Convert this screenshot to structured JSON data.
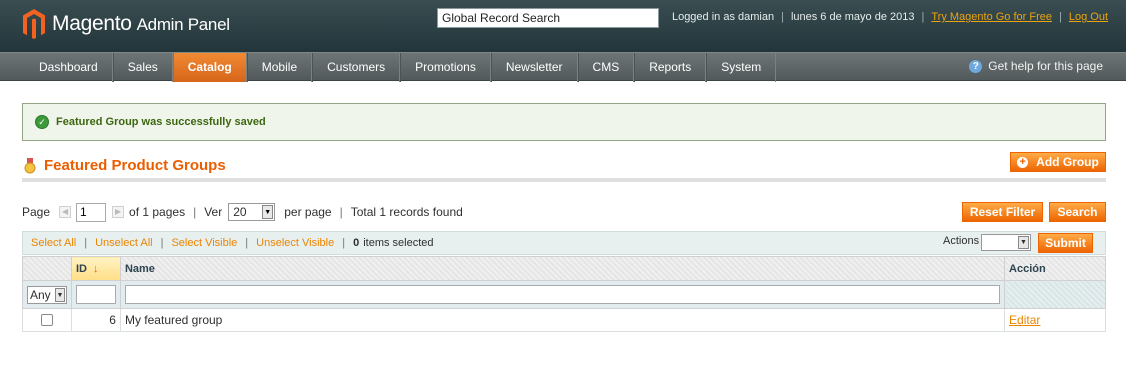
{
  "header": {
    "brand": "Magento",
    "brand_suffix": "Admin Panel",
    "search_value": "Global Record Search",
    "logged_in": "Logged in as damian",
    "date": "lunes 6 de mayo de 2013",
    "try_link": "Try Magento Go for Free",
    "logout": "Log Out"
  },
  "nav": {
    "items": [
      "Dashboard",
      "Sales",
      "Catalog",
      "Mobile",
      "Customers",
      "Promotions",
      "Newsletter",
      "CMS",
      "Reports",
      "System"
    ],
    "active": "Catalog",
    "help": "Get help for this page"
  },
  "message": {
    "text": "Featured Group was successfully saved"
  },
  "page": {
    "title": "Featured Product Groups",
    "add_button": "Add Group"
  },
  "pager": {
    "page_label": "Page",
    "page_value": "1",
    "of_pages": "of 1 pages",
    "view_label": "Ver",
    "per_page_value": "20",
    "per_page_label": "per page",
    "total": "Total 1 records found",
    "reset_button": "Reset Filter",
    "search_button": "Search"
  },
  "massaction": {
    "select_all": "Select All",
    "unselect_all": "Unselect All",
    "select_visible": "Select Visible",
    "unselect_visible": "Unselect Visible",
    "selected_count": "0",
    "selected_label": "items selected",
    "actions_label": "Actions",
    "actions_value": "",
    "submit_button": "Submit"
  },
  "grid": {
    "columns": {
      "id": "ID",
      "name": "Name",
      "action": "Acción"
    },
    "filter": {
      "any": "Any"
    },
    "rows": [
      {
        "id": "6",
        "name": "My featured group",
        "action": "Editar"
      }
    ]
  },
  "colors": {
    "accent": "#eb5e00",
    "button": "#ed6502",
    "header": "#2d3f43"
  }
}
